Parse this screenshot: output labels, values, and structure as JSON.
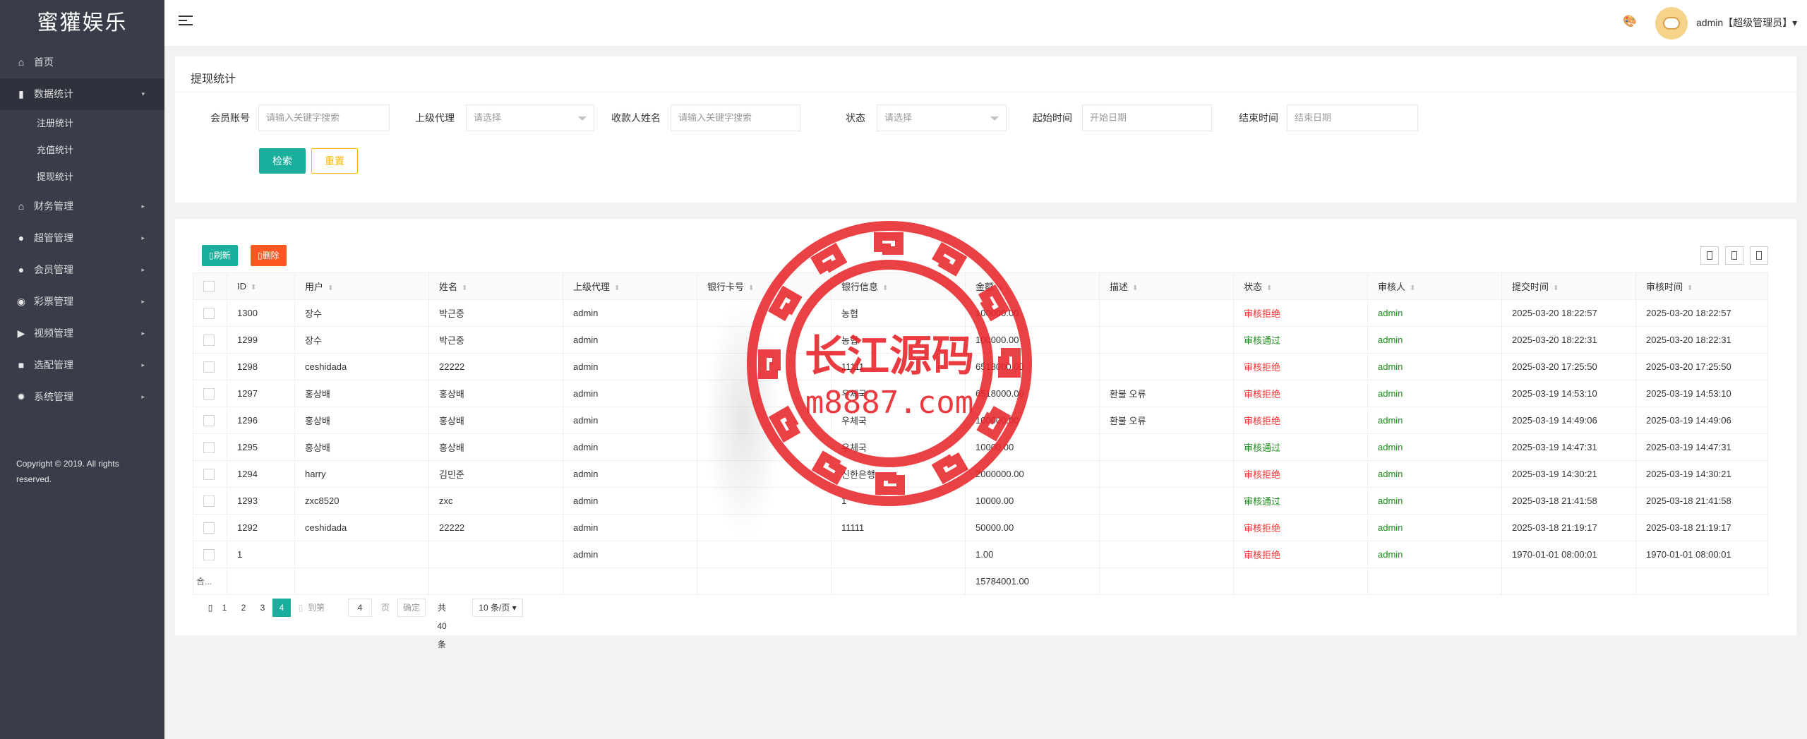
{
  "app": {
    "title": "蜜獾娱乐"
  },
  "sidebar": {
    "items": [
      {
        "label": "首页",
        "icon": "home-icon"
      },
      {
        "label": "数据统计",
        "icon": "bar-chart-icon",
        "open": true,
        "children": [
          "注册统计",
          "充值统计",
          "提现统计"
        ]
      },
      {
        "label": "财务管理",
        "icon": "bank-icon"
      },
      {
        "label": "超管管理",
        "icon": "user-icon"
      },
      {
        "label": "会员管理",
        "icon": "users-icon"
      },
      {
        "label": "彩票管理",
        "icon": "gamepad-icon"
      },
      {
        "label": "视频管理",
        "icon": "video-icon"
      },
      {
        "label": "选配管理",
        "icon": "camera-icon"
      },
      {
        "label": "系统管理",
        "icon": "gear-icon"
      }
    ],
    "copyright": "Copyright © 2019. All rights reserved."
  },
  "topbar": {
    "user": "admin【超级管理员】▾"
  },
  "search": {
    "title": "提现统计",
    "fields": [
      {
        "label": "会员账号",
        "placeholder": "请输入关键字搜索"
      },
      {
        "label": "上级代理",
        "placeholder": "请选择"
      },
      {
        "label": "收款人姓名",
        "placeholder": "请输入关键字搜索"
      },
      {
        "label": "状态",
        "placeholder": "请选择"
      },
      {
        "label": "起始时间",
        "placeholder": "开始日期"
      },
      {
        "label": "结束时间",
        "placeholder": "结束日期"
      }
    ],
    "search_label": "检索",
    "reset_label": "重置"
  },
  "toolbar": {
    "refresh_label": "刷新",
    "delete_label": "删除"
  },
  "table": {
    "columns": [
      "ID",
      "用户",
      "姓名",
      "上级代理",
      "银行卡号",
      "银行信息",
      "金额",
      "描述",
      "状态",
      "审核人",
      "提交时间",
      "审核时间"
    ],
    "rows": [
      [
        "1300",
        "장수",
        "박근중",
        "admin",
        "",
        "농협",
        "100000.00",
        "",
        "审核拒绝",
        "admin",
        "2025-03-20 18:22:57",
        "2025-03-20 18:22:57"
      ],
      [
        "1299",
        "장수",
        "박근중",
        "admin",
        "",
        "농협",
        "100000.00",
        "",
        "审核通过",
        "admin",
        "2025-03-20 18:22:31",
        "2025-03-20 18:22:31"
      ],
      [
        "1298",
        "ceshidada",
        "22222",
        "admin",
        "",
        "11111",
        "6518000.00",
        "",
        "审核拒绝",
        "admin",
        "2025-03-20 17:25:50",
        "2025-03-20 17:25:50"
      ],
      [
        "1297",
        "홍상배",
        "홍상배",
        "admin",
        "",
        "우체국",
        "6518000.00",
        "환불 오류",
        "审核拒绝",
        "admin",
        "2025-03-19 14:53:10",
        "2025-03-19 14:53:10"
      ],
      [
        "1296",
        "홍상배",
        "홍상배",
        "admin",
        "",
        "우체국",
        "100000.00",
        "환불 오류",
        "审核拒绝",
        "admin",
        "2025-03-19 14:49:06",
        "2025-03-19 14:49:06"
      ],
      [
        "1295",
        "홍상배",
        "홍상배",
        "admin",
        "",
        "우체국",
        "10000.00",
        "",
        "审核通过",
        "admin",
        "2025-03-19 14:47:31",
        "2025-03-19 14:47:31"
      ],
      [
        "1294",
        "harry",
        "김민준",
        "admin",
        "",
        "신한은행",
        "2000000.00",
        "",
        "审核拒绝",
        "admin",
        "2025-03-19 14:30:21",
        "2025-03-19 14:30:21"
      ],
      [
        "1293",
        "zxc8520",
        "zxc",
        "admin",
        "",
        "1",
        "10000.00",
        "",
        "审核通过",
        "admin",
        "2025-03-18 21:41:58",
        "2025-03-18 21:41:58"
      ],
      [
        "1292",
        "ceshidada",
        "22222",
        "admin",
        "",
        "11111",
        "50000.00",
        "",
        "审核拒绝",
        "admin",
        "2025-03-18 21:19:17",
        "2025-03-18 21:19:17"
      ],
      [
        "1",
        "",
        "",
        "admin",
        "",
        "",
        "1.00",
        "",
        "审核拒绝",
        "admin",
        "1970-01-01 08:00:01",
        "1970-01-01 08:00:01"
      ]
    ],
    "total_label": "合...",
    "total_amount": "15784001.00"
  },
  "pager": {
    "pages": [
      "1",
      "2",
      "3",
      "4"
    ],
    "current": "4",
    "goto_label": "到第",
    "goto_value": "4",
    "page_suffix": "页",
    "confirm_label": "确定",
    "total": "共 40 条",
    "per_page": "10 条/页"
  },
  "watermark": {
    "title": "长江源码",
    "site": "m8887.com"
  },
  "colors": {
    "sidebar": "#393d49",
    "accent": "#1aaf9c",
    "danger": "#ff5722",
    "warn": "#ffb800",
    "watermark": "#e8272c"
  }
}
